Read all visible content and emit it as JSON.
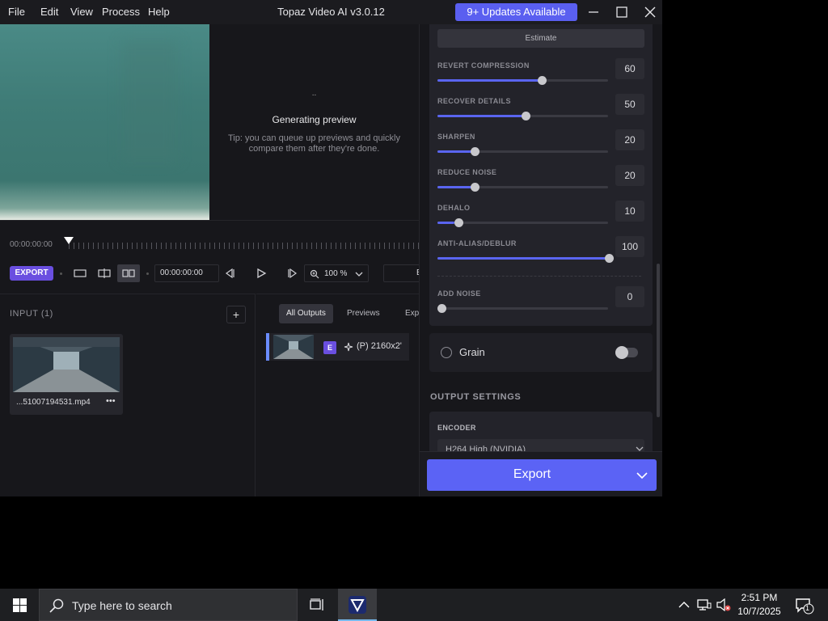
{
  "window": {
    "title": "Topaz Video AI  v3.0.12",
    "updates_label": "9+ Updates Available",
    "menu": [
      "File",
      "Edit",
      "View",
      "Process",
      "Help"
    ]
  },
  "preview": {
    "loading_dots": "..",
    "status_title": "Generating preview",
    "tip": "Tip: you can queue up previews and quickly compare them after they're done."
  },
  "timeline": {
    "start_time": "00:00:00:00",
    "export_label": "EXPORT",
    "timecode": "00:00:00:00",
    "zoom_value": "100",
    "zoom_unit": "%",
    "back_label": "Bac"
  },
  "input": {
    "title": "INPUT (1)",
    "add_label": "+",
    "file_name": "...51007194531.mp4",
    "more_label": "•••"
  },
  "outputs": {
    "tabs": [
      "All Outputs",
      "Previews",
      "Export"
    ],
    "active_tab": "All Outputs",
    "row": {
      "badge": "E",
      "text": "(P)  2160x2'"
    }
  },
  "settings": {
    "estimate_label": "Estimate",
    "sliders": [
      {
        "label": "REVERT COMPRESSION",
        "value": "60",
        "level": 0.6
      },
      {
        "label": "RECOVER DETAILS",
        "value": "50",
        "level": 0.5
      },
      {
        "label": "SHARPEN",
        "value": "20",
        "level": 0.2
      },
      {
        "label": "REDUCE NOISE",
        "value": "20",
        "level": 0.2
      },
      {
        "label": "DEHALO",
        "value": "10",
        "level": 0.1
      },
      {
        "label": "ANTI-ALIAS/DEBLUR",
        "value": "100",
        "level": 1.0
      },
      {
        "label": "ADD NOISE",
        "value": "0",
        "level": 0.0
      }
    ],
    "grain_label": "Grain",
    "grain_enabled": false,
    "output_settings_title": "OUTPUT SETTINGS",
    "encoder_label": "ENCODER",
    "encoder_value": "H264 High (NVIDIA)",
    "export_label": "Export"
  },
  "taskbar": {
    "search_placeholder": "Type here to search",
    "time": "2:51 PM",
    "date": "10/7/2025",
    "notification_count": "1"
  },
  "colors": {
    "accent": "#5b63f5",
    "updates_button": "#5a5ff0",
    "badge_purple": "#6a4fe0",
    "panel_bg": "#17171b"
  }
}
